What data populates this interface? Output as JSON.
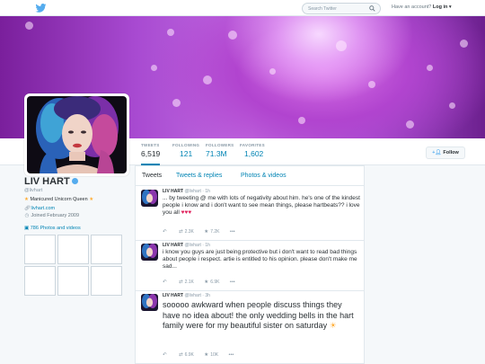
{
  "topnav": {
    "search_placeholder": "Search Twitter",
    "have_account": "Have an account?",
    "login": "Log in ▾"
  },
  "profile": {
    "name": "LIV HART",
    "handle": "@livhart",
    "bio": "Manicured Unicorn Queen",
    "website": "livhart.com",
    "joined": "Joined February 2009",
    "photos_link": "786 Photos and videos"
  },
  "stats": [
    {
      "label": "TWEETS",
      "value": "6,519"
    },
    {
      "label": "FOLLOWING",
      "value": "121"
    },
    {
      "label": "FOLLOWERS",
      "value": "71.3M"
    },
    {
      "label": "FAVORITES",
      "value": "1,602"
    }
  ],
  "follow_label": "Follow",
  "tabs": [
    "Tweets",
    "Tweets & replies",
    "Photos & videos"
  ],
  "tweets": [
    {
      "name": "LIV HART",
      "handle": "@livhart",
      "time": "· 1h",
      "text": "... by tweeting @ me with lots of negativity about him. he's one of the kindest people i know and i don't want to see mean things, please hartbeats?? i love you all",
      "emoji": "♥♥♥",
      "retweets": "2.3K",
      "favorites": "7.2K"
    },
    {
      "name": "LIV HART",
      "handle": "@livhart",
      "time": "· 1h",
      "text": "i know you guys are just being protective but i don't want to read bad things about people i respect. artie is entitled to his opinion. please don't make me sad...",
      "emoji": "",
      "retweets": "2.1K",
      "favorites": "6.9K"
    },
    {
      "name": "LIV HART",
      "handle": "@livhart",
      "time": "· 3h",
      "text": "sooooo awkward when people discuss things they have no idea about! the only wedding bells in the hart family were for my beautiful sister on saturday",
      "emoji": "☀",
      "retweets": "6.9K",
      "favorites": "10K"
    }
  ],
  "colors": {
    "accent": "#0084b4",
    "twitter_blue": "#55acee",
    "banner_purple": "#b144cf"
  }
}
